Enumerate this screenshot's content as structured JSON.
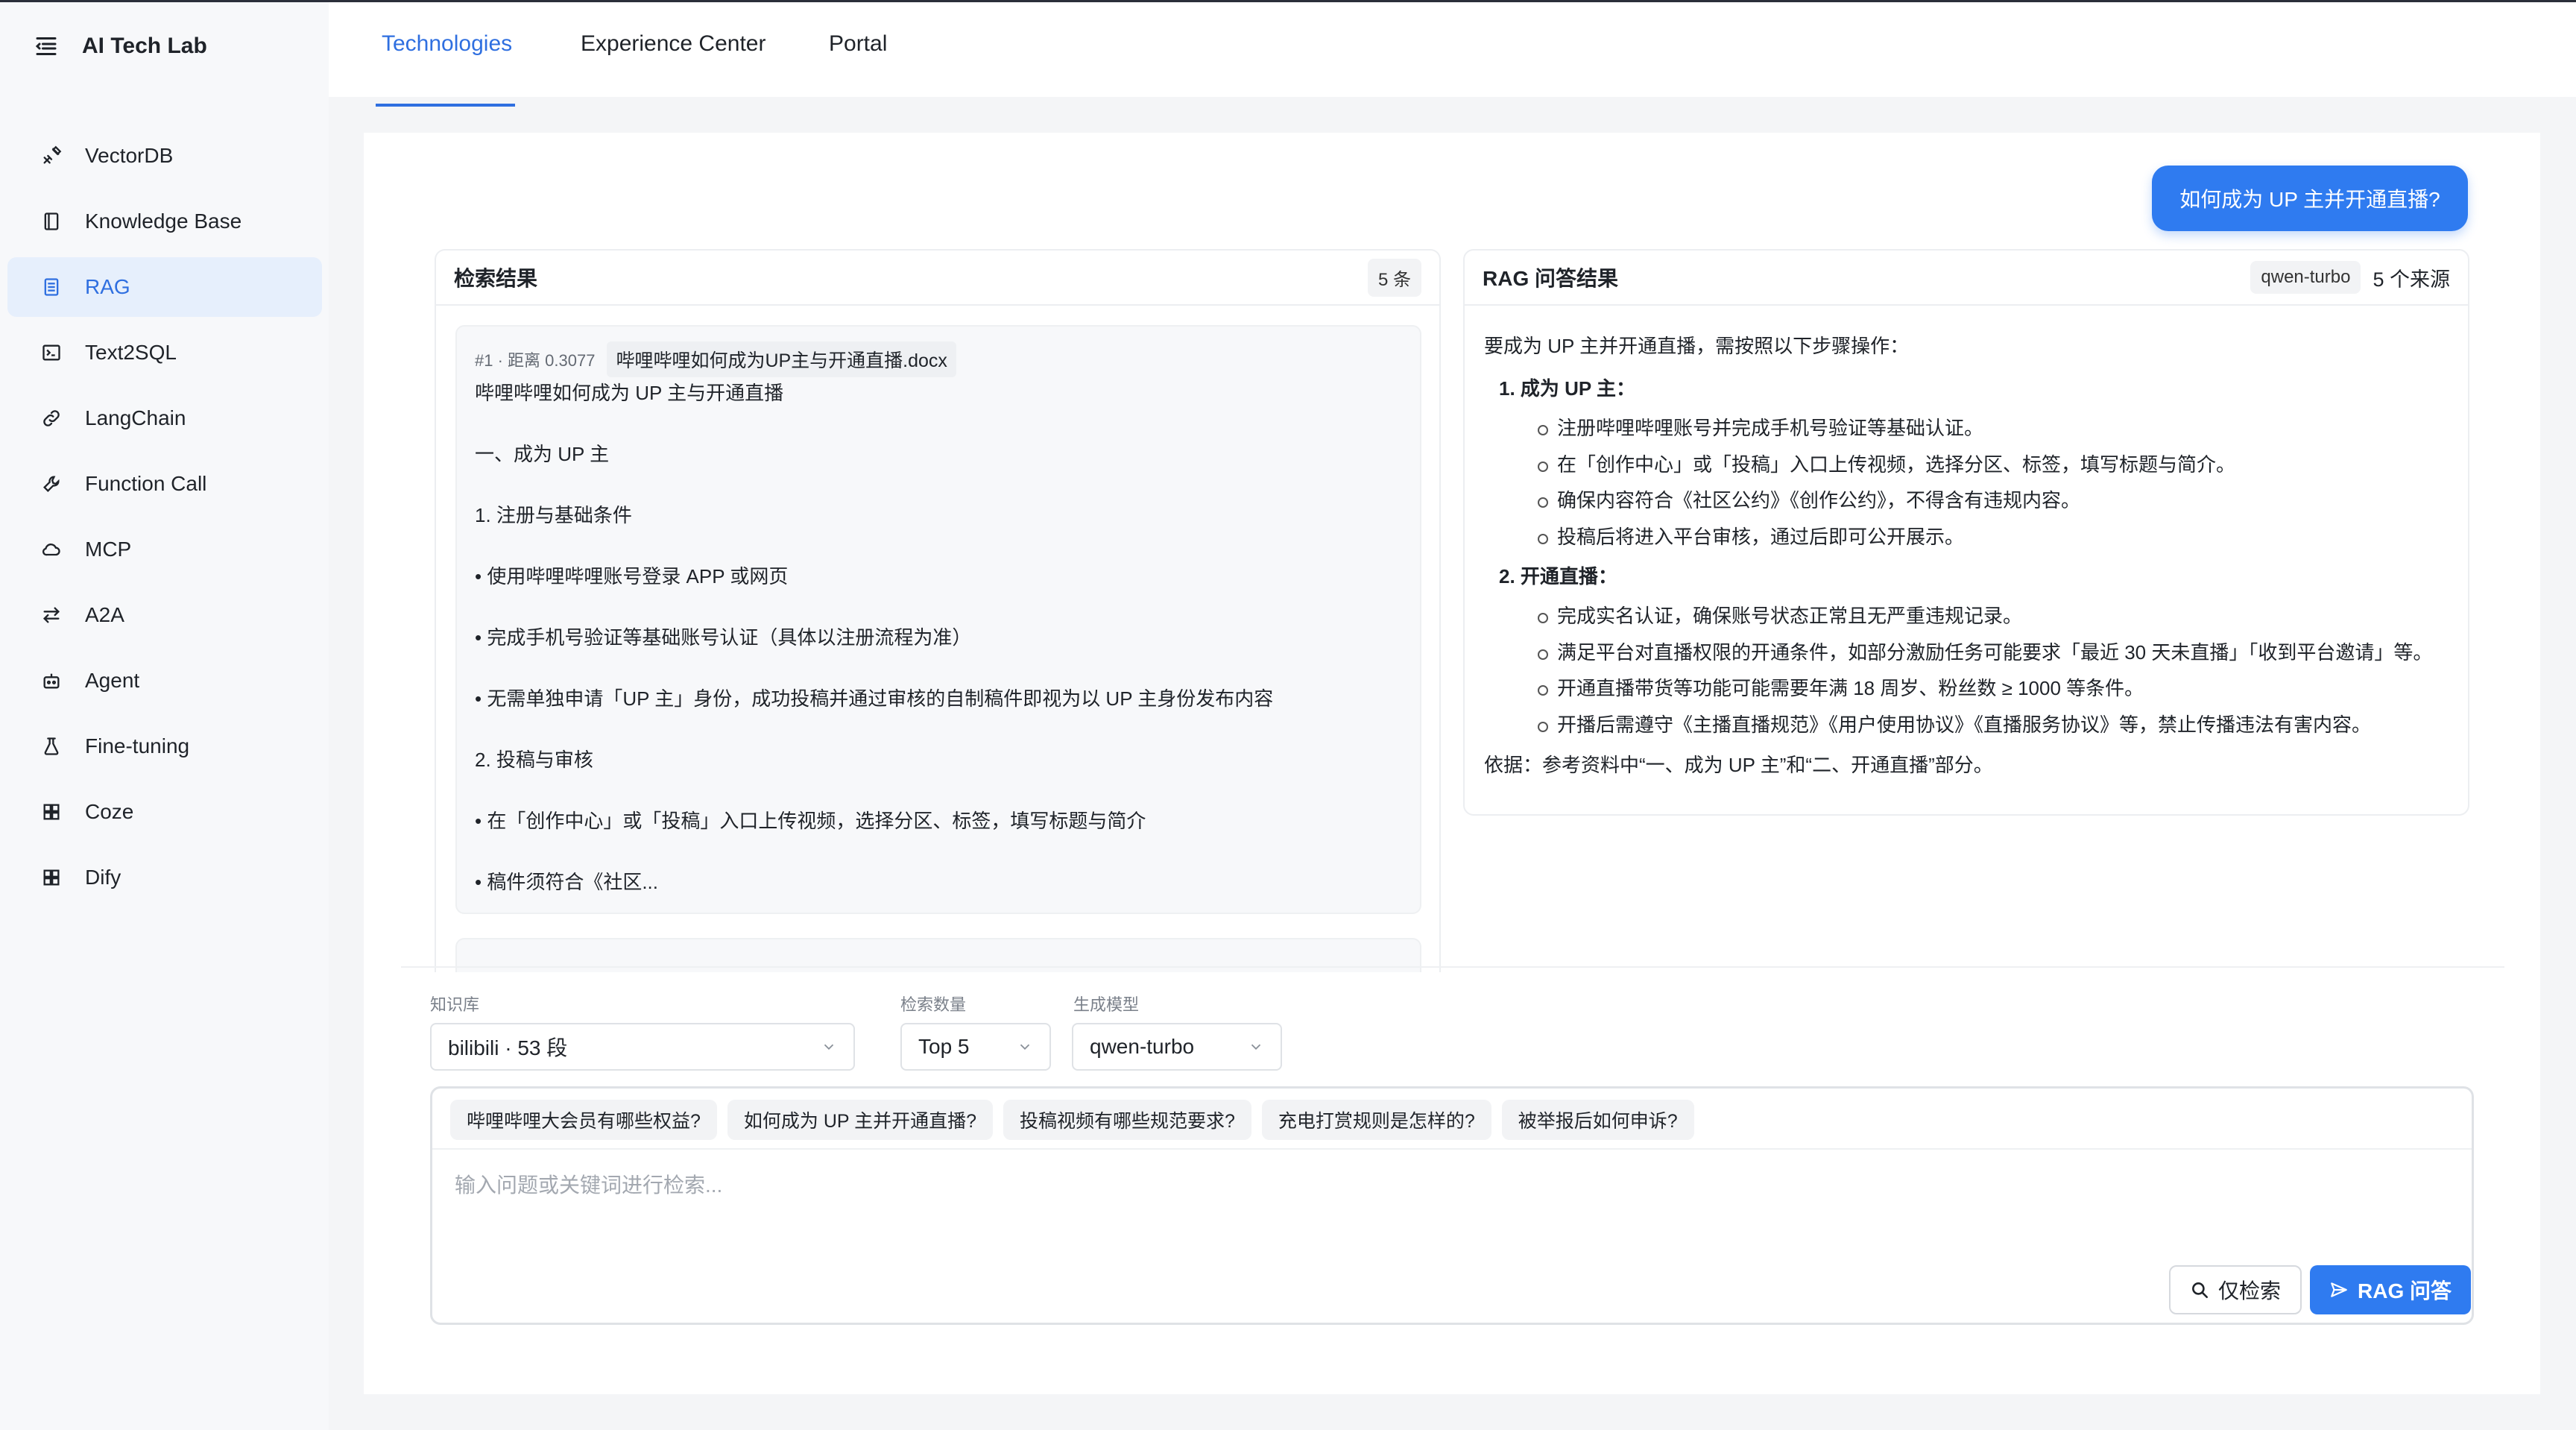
{
  "app": {
    "title": "AI Tech Lab"
  },
  "tabs": [
    {
      "label": "Technologies",
      "active": true
    },
    {
      "label": "Experience Center",
      "active": false
    },
    {
      "label": "Portal",
      "active": false
    }
  ],
  "sidebar": {
    "items": [
      {
        "label": "VectorDB",
        "icon": "plug-icon"
      },
      {
        "label": "Knowledge Base",
        "icon": "book-icon"
      },
      {
        "label": "RAG",
        "icon": "document-list-icon",
        "active": true
      },
      {
        "label": "Text2SQL",
        "icon": "terminal-icon"
      },
      {
        "label": "LangChain",
        "icon": "link-icon"
      },
      {
        "label": "Function Call",
        "icon": "wrench-icon"
      },
      {
        "label": "MCP",
        "icon": "cloud-icon"
      },
      {
        "label": "A2A",
        "icon": "swap-icon"
      },
      {
        "label": "Agent",
        "icon": "robot-icon"
      },
      {
        "label": "Fine-tuning",
        "icon": "flask-icon"
      },
      {
        "label": "Coze",
        "icon": "grid-icon"
      },
      {
        "label": "Dify",
        "icon": "grid-icon"
      }
    ]
  },
  "query": {
    "text": "如何成为 UP 主并开通直播?"
  },
  "retrieval": {
    "title": "检索结果",
    "count": "5 条",
    "results": [
      {
        "meta": "#1 · 距离 0.3077",
        "file": "哔哩哔哩如何成为UP主与开通直播.docx",
        "lines": [
          "哔哩哔哩如何成为 UP 主与开通直播",
          "一、成为 UP 主",
          "1. 注册与基础条件",
          "• 使用哔哩哔哩账号登录 APP 或网页",
          "• 完成手机号验证等基础账号认证（具体以注册流程为准）",
          "• 无需单独申请「UP 主」身份，成功投稿并通过审核的自制稿件即视为以 UP 主身份发布内容",
          "2. 投稿与审核",
          "• 在「创作中心」或「投稿」入口上传视频，选择分区、标签，填写标题与简介",
          "• 稿件须符合《社区..."
        ]
      }
    ]
  },
  "answer": {
    "title": "RAG 问答结果",
    "model": "qwen-turbo",
    "sources": "5 个来源",
    "intro": "要成为 UP 主并开通直播，需按照以下步骤操作：",
    "sections": [
      {
        "heading": "1. 成为 UP 主：",
        "items": [
          "注册哔哩哔哩账号并完成手机号验证等基础认证。",
          "在「创作中心」或「投稿」入口上传视频，选择分区、标签，填写标题与简介。",
          "确保内容符合《社区公约》《创作公约》，不得含有违规内容。",
          "投稿后将进入平台审核，通过后即可公开展示。"
        ]
      },
      {
        "heading": "2. 开通直播：",
        "items": [
          "完成实名认证，确保账号状态正常且无严重违规记录。",
          "满足平台对直播权限的开通条件，如部分激励任务可能要求「最近 30 天未直播」「收到平台邀请」等。",
          "开通直播带货等功能可能需要年满 18 周岁、粉丝数 ≥ 1000 等条件。",
          "开播后需遵守《主播直播规范》《用户使用协议》《直播服务协议》等，禁止传播违法有害内容。"
        ]
      }
    ],
    "footer": "依据：参考资料中“一、成为 UP 主”和“二、开通直播”部分。"
  },
  "controls": {
    "kb_label": "知识库",
    "kb_value": "bilibili · 53 段",
    "topk_label": "检索数量",
    "topk_value": "Top 5",
    "model_label": "生成模型",
    "model_value": "qwen-turbo"
  },
  "suggestions": [
    "哔哩哔哩大会员有哪些权益?",
    "如何成为 UP 主并开通直播?",
    "投稿视频有哪些规范要求?",
    "充电打赏规则是怎样的?",
    "被举报后如何申诉?"
  ],
  "input": {
    "placeholder": "输入问题或关键词进行检索..."
  },
  "buttons": {
    "search_only": "仅检索",
    "rag": "RAG 问答"
  },
  "colors": {
    "accent": "#2f7bf0",
    "active_bg": "#e6effc"
  }
}
